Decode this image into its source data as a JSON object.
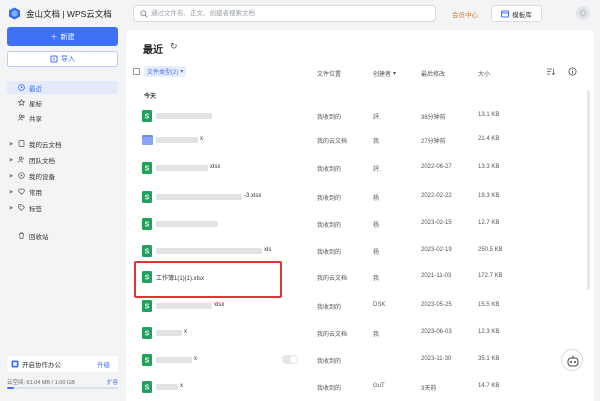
{
  "topbar": {
    "brand": "金山文档 | WPS云文档",
    "search_placeholder": "通过文件名、正文、创建者搜索文档",
    "member_center": "会员中心",
    "template_lib": "模板库"
  },
  "sidebar": {
    "new_label": "新建",
    "import_label": "导入",
    "items": [
      {
        "label": "最近",
        "icon": "clock-icon",
        "active": true
      },
      {
        "label": "星标",
        "icon": "star-icon"
      },
      {
        "label": "共享",
        "icon": "share-icon"
      },
      {
        "label": "我的云文档",
        "icon": "cloud-doc-icon",
        "caret": true
      },
      {
        "label": "团队文档",
        "icon": "team-icon",
        "caret": true
      },
      {
        "label": "我的设备",
        "icon": "device-icon",
        "caret": true
      },
      {
        "label": "常用",
        "icon": "favorite-icon",
        "caret": true
      },
      {
        "label": "标签",
        "icon": "tag-icon",
        "caret": true
      },
      {
        "label": "回收站",
        "icon": "trash-icon"
      }
    ],
    "collab_label": "开启协作办公",
    "upgrade_label": "升级",
    "storage_text": "云空间: 61.04 MB / 1.00 GB",
    "storage_fraction": 0.06,
    "expand_label": "扩容"
  },
  "main": {
    "title": "最近",
    "filter_label": "文件类型(2)",
    "columns": {
      "location": "文件位置",
      "creator": "创建者",
      "modified": "最后修改",
      "size": "大小"
    },
    "group_today": "今天",
    "files": [
      {
        "name": "",
        "loc": "我收到的",
        "creator": "評.",
        "modified": "38分钟前",
        "size": "13.1 KB",
        "type": "sheet"
      },
      {
        "name": "x",
        "loc": "我的云文档",
        "creator": "我",
        "modified": "27分钟前",
        "size": "21.4 KB",
        "type": "folder"
      },
      {
        "name": "xlsx",
        "loc": "我收到的",
        "creator": "評.",
        "modified": "2022-06-27",
        "size": "13.3 KB",
        "type": "sheet"
      },
      {
        "name": "-3.xlsx",
        "loc": "我收到的",
        "creator": "杨",
        "modified": "2022-02-22",
        "size": "19.3 KB",
        "type": "sheet"
      },
      {
        "name": "",
        "loc": "我收到的",
        "creator": "杨",
        "modified": "2023-02-15",
        "size": "12.7 KB",
        "type": "sheet"
      },
      {
        "name": "xls",
        "loc": "我收到的",
        "creator": "杨",
        "modified": "2023-02-19",
        "size": "250.5 KB",
        "type": "sheet"
      },
      {
        "name": "工作簿1(1)(1).xlsx",
        "loc": "我的云文档",
        "creator": "我",
        "modified": "2021-11-03",
        "size": "172.7 KB",
        "type": "sheet"
      },
      {
        "name": "xlsx",
        "loc": "我收到的",
        "creator": "DSK",
        "modified": "2023-05-25",
        "size": "15.5 KB",
        "type": "sheet"
      },
      {
        "name": "x",
        "loc": "我的云文档",
        "creator": "我",
        "modified": "2023-06-03",
        "size": "12.3 KB",
        "type": "sheet"
      },
      {
        "name": "x",
        "loc": "我收到的",
        "creator": "",
        "modified": "2023-11-30",
        "size": "35.1 KB",
        "type": "sheet"
      },
      {
        "name": "x",
        "loc": "我收到的",
        "creator": "GuT",
        "modified": "3天前",
        "size": "14.7 KB",
        "type": "sheet"
      }
    ]
  },
  "colors": {
    "accent": "#3d72f6",
    "sheet": "#1fa25c",
    "folder": "#6f8cf3",
    "highlight": "#e03535"
  }
}
